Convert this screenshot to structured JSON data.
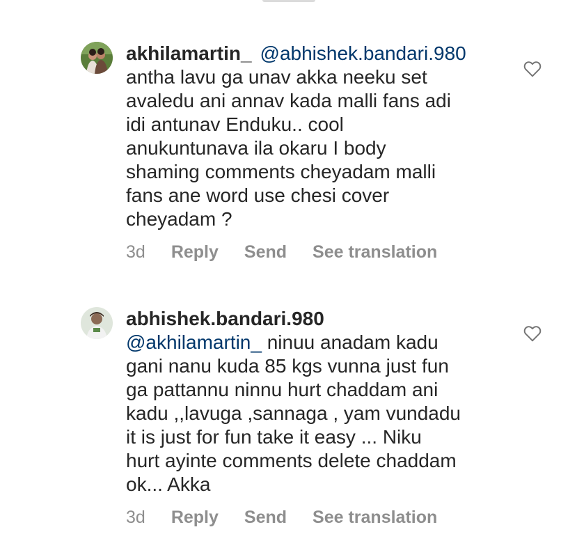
{
  "comments": [
    {
      "username": "akhilamartin_",
      "mention": "@abhishek.bandari.980",
      "text": "antha lavu ga unav akka neeku set\navaledu ani annav kada malli fans adi\nidi antunav Enduku.. cool\nanukuntunava ila okaru I body\nshaming comments cheyadam malli\nfans ane word use chesi cover\ncheyadam ?",
      "time": "3d",
      "reply_label": "Reply",
      "send_label": "Send",
      "translate_label": "See translation",
      "avatar_icon": "profile-photo-couple"
    },
    {
      "username": "abhishek.bandari.980",
      "mention": "@akhilamartin_",
      "text": "  ninuu anadam kadu\ngani nanu kuda 85 kgs vunna just fun\nga pattannu ninnu hurt chaddam ani\nkadu ,,lavuga ,sannaga , yam vundadu\nit is just for fun take it easy ... Niku\nhurt ayinte comments delete chaddam\nok... Akka",
      "time": "3d",
      "reply_label": "Reply",
      "send_label": "Send",
      "translate_label": "See translation",
      "avatar_icon": "profile-photo-person"
    }
  ],
  "colors": {
    "mention": "#00376b",
    "meta": "#8e8e8e",
    "text": "#262626"
  }
}
